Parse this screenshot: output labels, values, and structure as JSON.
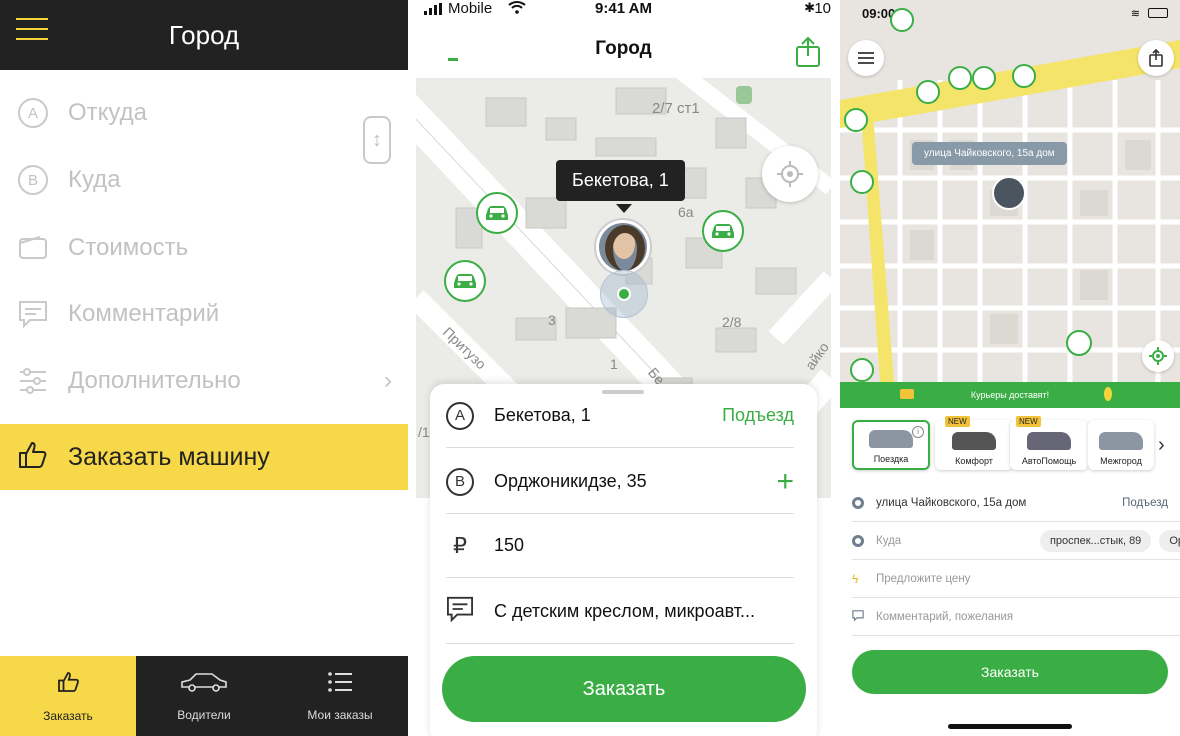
{
  "screen1": {
    "title": "Город",
    "menu": [
      {
        "icon": "A",
        "label": "Откуда"
      },
      {
        "icon": "B",
        "label": "Куда"
      },
      {
        "icon": "wallet-icon",
        "label": "Стоимость"
      },
      {
        "icon": "comment-icon",
        "label": "Комментарий"
      },
      {
        "icon": "sliders-icon",
        "label": "Дополнительно"
      }
    ],
    "order_label": "Заказать машину",
    "nav": [
      {
        "icon": "thumb-icon",
        "label": "Заказать"
      },
      {
        "icon": "car-icon",
        "label": "Водители"
      },
      {
        "icon": "list-icon",
        "label": "Мои заказы"
      }
    ],
    "colors": {
      "accent": "#f6d848",
      "header": "#222222"
    }
  },
  "screen2": {
    "status": {
      "carrier": "Mobile",
      "time": "9:41 AM",
      "battery": "10"
    },
    "title": "Город",
    "map_labels": [
      "2/7 ст1",
      "6а",
      "3",
      "1",
      "2/8",
      "Притузо",
      "Бе",
      "айко",
      "/1"
    ],
    "pin_label": "Бекетова, 1",
    "from": {
      "badge": "A",
      "value": "Бекетова, 1",
      "action": "Подъезд"
    },
    "to": {
      "badge": "B",
      "value": "Орджоникидзе, 35"
    },
    "price": {
      "icon": "₽",
      "value": "150"
    },
    "comment": "С детским креслом, микроавт...",
    "order_button": "Заказать",
    "colors": {
      "accent": "#3aae45"
    }
  },
  "screen3": {
    "status": {
      "time": "09:00"
    },
    "pin_label": "улица Чайковского, 15а дом",
    "banner": "Курьеры доставят!",
    "tariffs": [
      {
        "label": "Поездка",
        "selected": true
      },
      {
        "label": "Комфорт",
        "badge": "NEW"
      },
      {
        "label": "АвтоПомощь",
        "badge": "NEW"
      },
      {
        "label": "Межгород"
      }
    ],
    "from": {
      "value": "улица Чайковского, 15а дом",
      "action": "Подъезд"
    },
    "to": {
      "placeholder": "Куда",
      "chips": [
        "проспек...стык, 89",
        "Ор"
      ]
    },
    "price_placeholder": "Предложите цену",
    "comment_placeholder": "Комментарий, пожелания",
    "order_button": "Заказать"
  }
}
